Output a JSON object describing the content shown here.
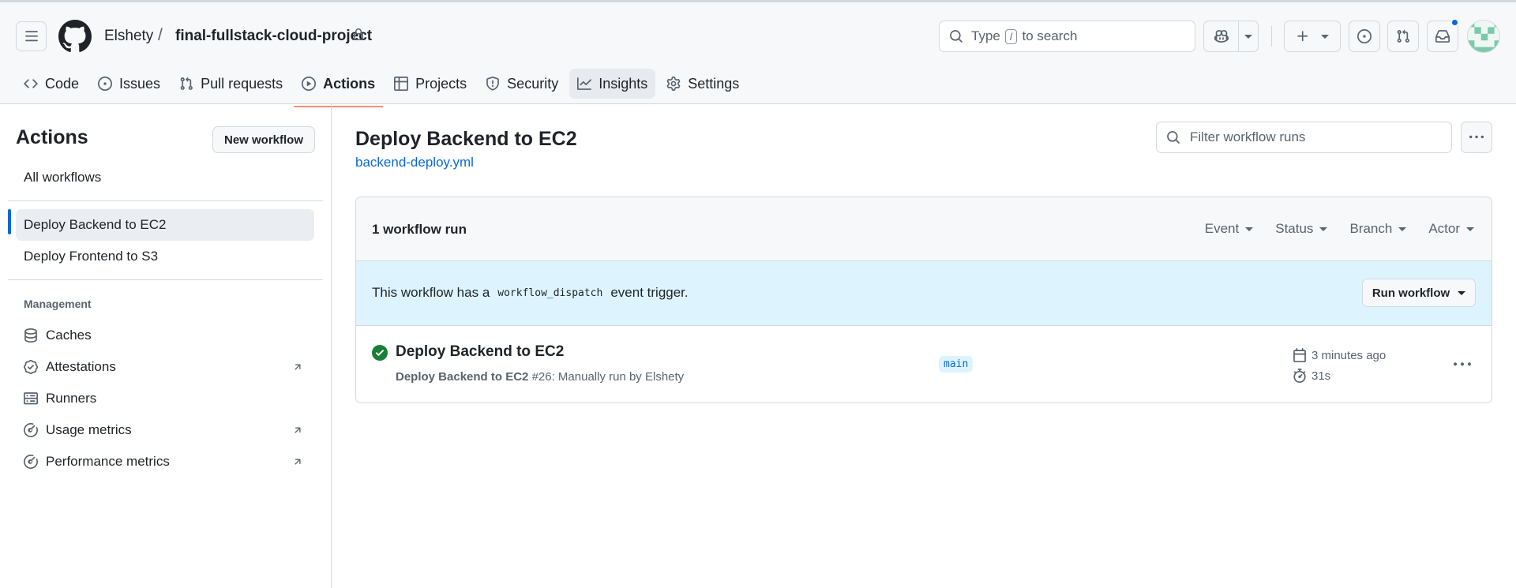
{
  "header": {
    "owner": "Elshety",
    "separator": "/",
    "repo": "final-fullstack-cloud-project",
    "search_prefix": "Type",
    "search_key": "/",
    "search_suffix": "to search"
  },
  "tabs": [
    {
      "label": "Code",
      "icon": "code-icon"
    },
    {
      "label": "Issues",
      "icon": "issue-opened-icon"
    },
    {
      "label": "Pull requests",
      "icon": "git-pull-request-icon"
    },
    {
      "label": "Actions",
      "icon": "play-icon",
      "selected": true
    },
    {
      "label": "Projects",
      "icon": "table-icon"
    },
    {
      "label": "Security",
      "icon": "shield-icon"
    },
    {
      "label": "Insights",
      "icon": "graph-icon"
    },
    {
      "label": "Settings",
      "icon": "gear-icon"
    }
  ],
  "sidebar": {
    "title": "Actions",
    "new_workflow": "New workflow",
    "all_workflows": "All workflows",
    "workflows": [
      "Deploy Backend to EC2",
      "Deploy Frontend to S3"
    ],
    "management_heading": "Management",
    "management": [
      {
        "label": "Caches",
        "icon": "database-icon",
        "external": false
      },
      {
        "label": "Attestations",
        "icon": "verified-icon",
        "external": true
      },
      {
        "label": "Runners",
        "icon": "server-icon",
        "external": false
      },
      {
        "label": "Usage metrics",
        "icon": "meter-icon",
        "external": true
      },
      {
        "label": "Performance metrics",
        "icon": "meter-icon",
        "external": true
      }
    ]
  },
  "main": {
    "title": "Deploy Backend to EC2",
    "file": "backend-deploy.yml",
    "filter_placeholder": "Filter workflow runs",
    "run_count": "1 workflow run",
    "filters": [
      "Event",
      "Status",
      "Branch",
      "Actor"
    ],
    "dispatch_pre": "This workflow has a",
    "dispatch_code": "workflow_dispatch",
    "dispatch_post": "event trigger.",
    "run_workflow": "Run workflow",
    "run": {
      "title": "Deploy Backend to EC2",
      "sub_bold": "Deploy Backend to EC2",
      "sub_rest": "#26: Manually run by Elshety",
      "branch": "main",
      "time_ago": "3 minutes ago",
      "duration": "31s",
      "status": "success"
    }
  },
  "colors": {
    "accent": "#0969da",
    "success": "#1a7f37",
    "tab_underline": "#fd8c73",
    "dispatch_bg": "#ddf4ff"
  }
}
